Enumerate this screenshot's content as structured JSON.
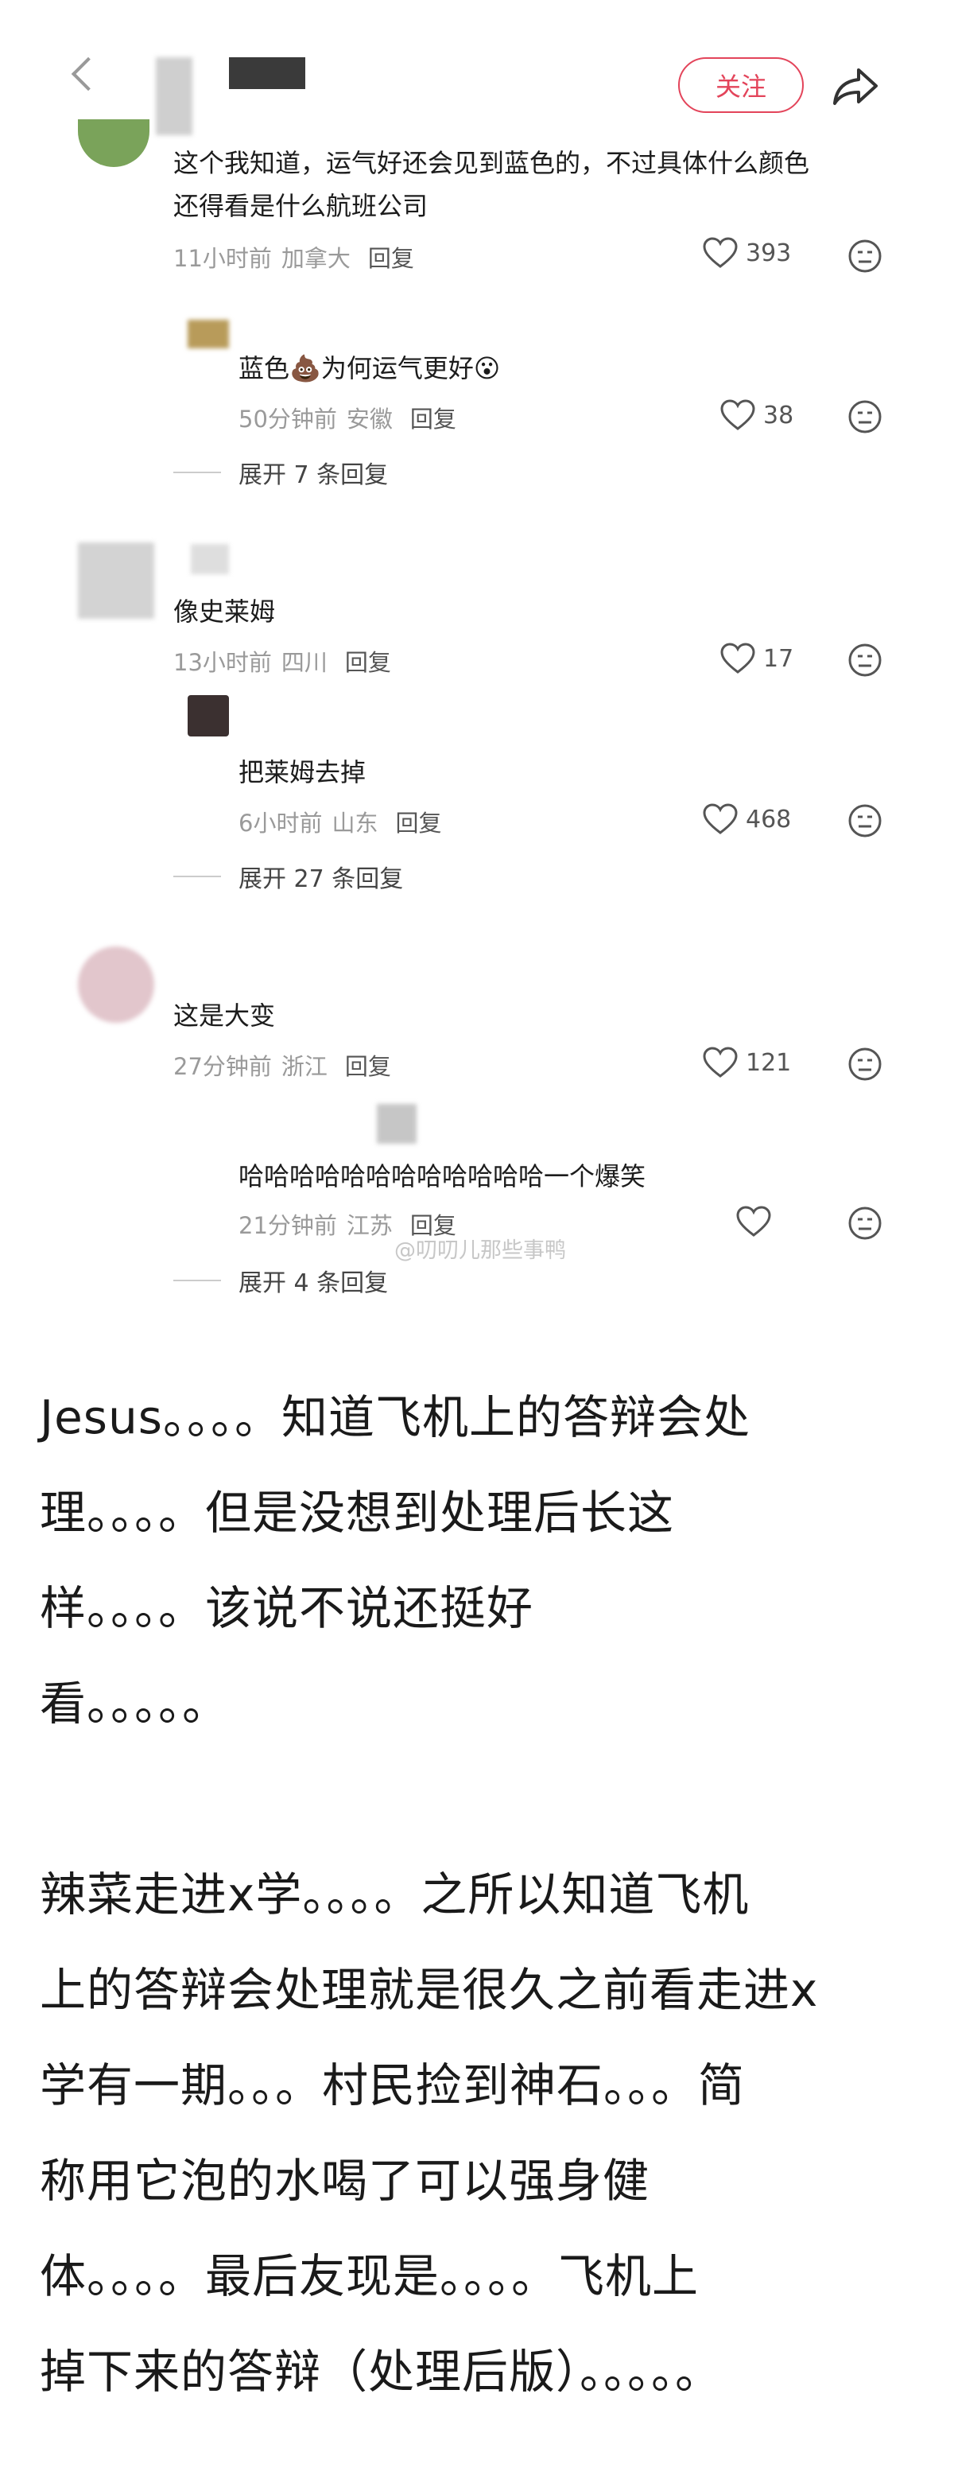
{
  "header": {
    "follow_label": "关注"
  },
  "comments": [
    {
      "text": "这个我知道，运气好还会见到蓝色的，不过具体什么颜色还得看是什么航班公司",
      "line1": "这个我知道，运气好还会见到蓝色的，不过具体什么颜色",
      "line2": "还得看是什么航班公司",
      "time": "11小时前",
      "region": "加拿大",
      "reply": "回复",
      "likes": "393"
    },
    {
      "text": "蓝色💩为何运气更好😮",
      "time": "50分钟前",
      "region": "安徽",
      "reply": "回复",
      "likes": "38",
      "expand": "展开 7 条回复"
    },
    {
      "text": "像史莱姆",
      "time": "13小时前",
      "region": "四川",
      "reply": "回复",
      "likes": "17"
    },
    {
      "text": "把莱姆去掉",
      "time": "6小时前",
      "region": "山东",
      "reply": "回复",
      "likes": "468",
      "expand": "展开 27 条回复"
    },
    {
      "text": "这是大变",
      "time": "27分钟前",
      "region": "浙江",
      "reply": "回复",
      "likes": "121"
    },
    {
      "text": "哈哈哈哈哈哈哈哈哈哈哈哈一个爆笑",
      "time": "21分钟前",
      "region": "江苏",
      "reply": "回复",
      "likes": "",
      "expand": "展开 4 条回复"
    }
  ],
  "watermark": "@叨叨儿那些事鸭",
  "post": {
    "lines": [
      "Jesus。。。。知道飞机上的答辩会处",
      "理。。。。但是没想到处理后长这",
      "样。。。。该说不说还挺好",
      "看。。。。。",
      "",
      "辣菜走进x学。。。。之所以知道飞机",
      "上的答辩会处理就是很久之前看走进x",
      "学有一期。。。村民捡到神石。。。简",
      "称用它泡的水喝了可以强身健",
      "体。。。。最后友现是。。。。飞机上",
      "掉下来的答辩（处理后版）。。。。。"
    ]
  },
  "colors": {
    "accent": "#e3445a",
    "meta_gray": "#9a9a9a"
  }
}
